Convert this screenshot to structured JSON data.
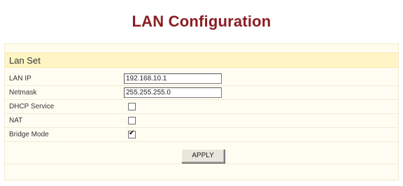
{
  "page": {
    "title": "LAN Configuration"
  },
  "section": {
    "header": "Lan Set"
  },
  "fields": {
    "lan_ip": {
      "label": "LAN IP",
      "value": "192.168.10.1"
    },
    "netmask": {
      "label": "Netmask",
      "value": "255.255.255.0"
    },
    "dhcp_service": {
      "label": "DHCP Service",
      "checked": false
    },
    "nat": {
      "label": "NAT",
      "checked": false
    },
    "bridge_mode": {
      "label": "Bridge Mode",
      "checked": true,
      "check_glyph": "✔"
    }
  },
  "actions": {
    "apply_label": "APPLY"
  },
  "colors": {
    "title": "#8b1e24",
    "section_header_bg": "#fff5c4",
    "panel_bg": "#fffdf2"
  }
}
